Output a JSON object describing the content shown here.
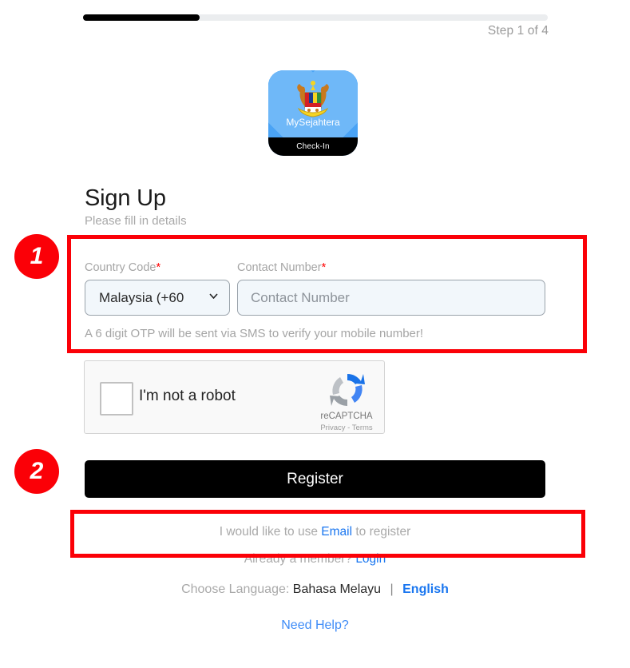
{
  "progress": {
    "step_label": "Step 1 of 4",
    "current_step": 1,
    "total_steps": 4,
    "percent": 25,
    "fill_color": "#000000",
    "track_color": "#ebedef"
  },
  "logo": {
    "app_name": "MySejahtera",
    "badge_label": "Check-In",
    "background_color": "#4aa3f5"
  },
  "heading": {
    "title": "Sign Up",
    "subtitle": "Please fill in details"
  },
  "form": {
    "country_code": {
      "label": "Country Code",
      "required_mark": "*",
      "selected": "Malaysia (+60",
      "options": [
        "Malaysia (+60"
      ]
    },
    "contact_number": {
      "label": "Contact Number",
      "required_mark": "*",
      "value": "",
      "placeholder": "Contact Number"
    },
    "otp_hint": "A 6 digit OTP will be sent via SMS to verify your mobile number!"
  },
  "recaptcha": {
    "checkbox_label": "I'm not a robot",
    "brand": "reCAPTCHA",
    "privacy_label": "Privacy",
    "separator": "-",
    "terms_label": "Terms",
    "checked": false
  },
  "actions": {
    "register_label": "Register"
  },
  "alt_register": {
    "prefix": "I would like to use",
    "link": "Email",
    "suffix": "to register"
  },
  "member": {
    "prefix": "Already a member?",
    "link": "Login"
  },
  "language": {
    "prefix": "Choose Language:",
    "option_malay": "Bahasa Melayu",
    "divider": "|",
    "option_english": "English",
    "selected": "English"
  },
  "help": {
    "label": "Need Help?"
  },
  "annotations": {
    "badge_1": "1",
    "badge_2": "2",
    "color": "#fb0007"
  }
}
